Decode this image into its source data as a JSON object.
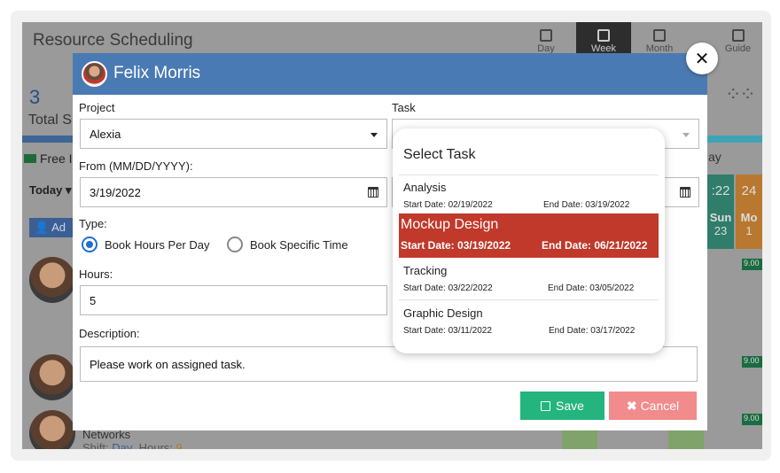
{
  "app": {
    "title": "Resource Scheduling",
    "views": [
      {
        "label": "Day",
        "icon": "calendar-icon"
      },
      {
        "label": "Week",
        "icon": "calendar-icon"
      },
      {
        "label": "Month",
        "icon": "calendar-icon"
      },
      {
        "label": "Guide",
        "icon": "guide-icon"
      }
    ],
    "stat_value": "3",
    "stat_label": "Total S",
    "free_label": "Free I",
    "today_label": "Today",
    "add_label": "Ad",
    "day_column_label": "ay",
    "days": [
      {
        "top": ":22",
        "name": "Sun",
        "num": "23"
      },
      {
        "top": "24",
        "name": "Mo",
        "num": "1"
      }
    ],
    "hour_badge": "9.00",
    "resource_dept": "Networks",
    "shift_label": "Shift:",
    "shift_value": "Day",
    "hours_label": "Hours:",
    "hours_value": "9"
  },
  "modal": {
    "title": "Felix Morris",
    "project": {
      "label": "Project",
      "value": "Alexia"
    },
    "task": {
      "label": "Task",
      "value": ""
    },
    "from": {
      "label": "From (MM/DD/YYYY):",
      "value": "3/19/2022"
    },
    "type": {
      "label": "Type:",
      "options": [
        "Book Hours Per Day",
        "Book Specific Time"
      ],
      "selected": "Book Hours Per Day"
    },
    "hours": {
      "label": "Hours:",
      "value": "5"
    },
    "description": {
      "label": "Description:",
      "value": "Please work on assigned task."
    },
    "save_label": "Save",
    "cancel_label": "Cancel"
  },
  "task_dropdown": {
    "title": "Select Task",
    "items": [
      {
        "name": "Analysis",
        "start": "Start Date: 02/19/2022",
        "end": "End Date: 03/19/2022",
        "selected": false
      },
      {
        "name": "Mockup Design",
        "start": "Start Date: 03/19/2022",
        "end": "End Date: 06/21/2022",
        "selected": true
      },
      {
        "name": "Tracking",
        "start": "Start Date: 03/22/2022",
        "end": "End Date: 03/05/2022",
        "selected": false
      },
      {
        "name": "Graphic Design",
        "start": "Start Date: 03/11/2022",
        "end": "End Date: 03/17/2022",
        "selected": false
      }
    ]
  },
  "colors": {
    "modal_header": "#4a7ab3",
    "selected_task": "#c0392b",
    "save": "#24b47e",
    "cancel": "#f28b8b"
  }
}
